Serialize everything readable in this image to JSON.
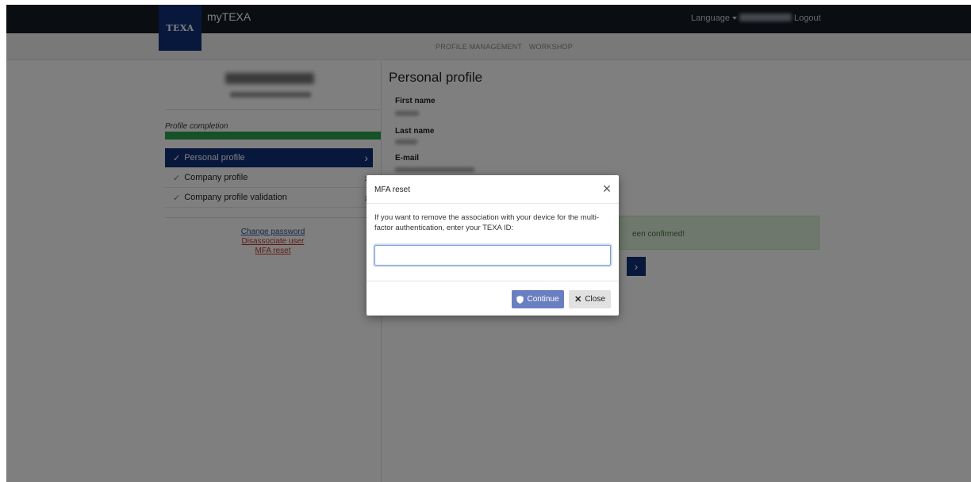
{
  "header": {
    "logo_text": "TEXA",
    "app_title": "myTEXA",
    "language_label": "Language",
    "logout_label": "Logout"
  },
  "subnav": {
    "items": [
      "PROFILE MANAGEMENT",
      "WORKSHOP"
    ]
  },
  "sidebar": {
    "completion_label": "Profile completion",
    "completion_percent": 100,
    "items": [
      {
        "label": "Personal profile",
        "active": true
      },
      {
        "label": "Company profile",
        "active": false
      },
      {
        "label": "Company profile validation",
        "active": false
      }
    ],
    "links": {
      "change_password": "Change password",
      "disassociate_user": "Disassociate user",
      "mfa_reset": "MFA reset"
    }
  },
  "main": {
    "title": "Personal profile",
    "fields": {
      "first_name_label": "First name",
      "last_name_label": "Last name",
      "email_label": "E-mail"
    },
    "confirm_text": "een confirmed!"
  },
  "modal": {
    "title": "MFA reset",
    "text": "If you want to remove the association with your device for the multi-factor authentication, enter your TEXA ID:",
    "input_value": "",
    "continue_label": "Continue",
    "close_label": "Close"
  },
  "colors": {
    "brand_navy": "#10317a",
    "topbar": "#141b24",
    "progress_green": "#2da44e",
    "continue_button": "#6a7fc1"
  }
}
